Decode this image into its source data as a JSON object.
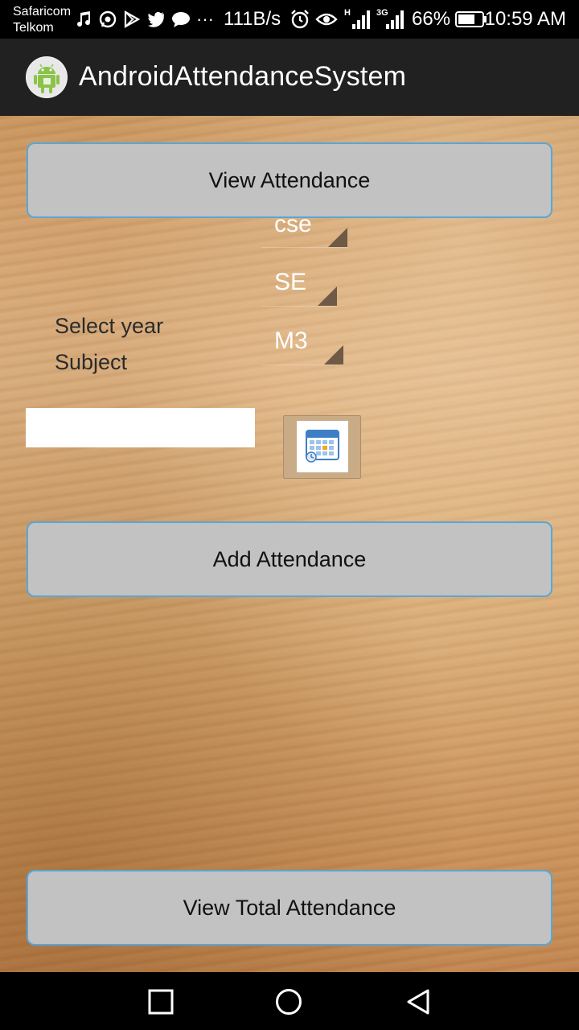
{
  "status_bar": {
    "carrier_1": "Safaricom",
    "carrier_2": "Telkom",
    "more_icon": "···",
    "net_speed": "111B/s",
    "signal_1_type": "H",
    "signal_2_type": "3G",
    "battery_percent": "66%",
    "time": "10:59 AM"
  },
  "action_bar": {
    "title": "AndroidAttendanceSystem"
  },
  "main": {
    "view_attendance_label": "View Attendance",
    "department_value": "cse",
    "year_value": "SE",
    "subject_value": "M3",
    "select_year_label": "Select year",
    "subject_label": "Subject",
    "date_value": "",
    "add_attendance_label": "Add Attendance",
    "view_total_label": "View Total Attendance"
  },
  "colors": {
    "button_bg": "#c2c2c2",
    "button_border": "#5aa6d6",
    "action_bar": "#212121"
  }
}
